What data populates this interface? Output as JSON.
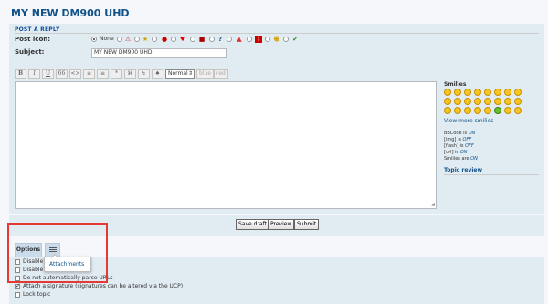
{
  "page": {
    "title": "MY NEW DM900 UHD"
  },
  "post": {
    "section_title": "POST A REPLY",
    "post_icon_label": "Post icon:",
    "none_label": "None",
    "subject_label": "Subject:",
    "subject_value": "MY NEW DM900 UHD"
  },
  "toolbar": {
    "bold": "B",
    "italic": "I",
    "underline": "U",
    "quote": "66",
    "code": "<>",
    "list": "≡",
    "list_ordered": "≡",
    "list_item": "*",
    "img": "⌘",
    "url": "↯",
    "flash": "♠",
    "font_size_value": "Normal",
    "color_blue": "blue",
    "color_red": "red"
  },
  "sidebar": {
    "smilies_title": "Smilies",
    "smilies": [
      ":D",
      ":)",
      ";)",
      ":(",
      ":o",
      ":shock:",
      ":?",
      "8-)",
      ":lol:",
      ":x",
      ":P",
      ":oops:",
      ":cry:",
      ":evil:",
      ":twisted:",
      ":roll:",
      ":!:",
      ":?:",
      ":idea:",
      ":arrow:",
      ":|",
      ":mrgreen:",
      ":geek:",
      ":ugeek:"
    ],
    "view_more": "View more smilies",
    "bbcode": "BBCode is ",
    "bbcode_state": "ON",
    "img": "[img] is ",
    "img_state": "OFF",
    "flash": "[flash] is ",
    "flash_state": "OFF",
    "url": "[url] is ",
    "url_state": "ON",
    "smilies_state_label": "Smilies are ",
    "smilies_state": "ON",
    "topic_review": "Topic review"
  },
  "buttons": {
    "save_draft": "Save draft",
    "preview": "Preview",
    "submit": "Submit"
  },
  "options": {
    "tab_label": "Options",
    "dropdown_item": "Attachments",
    "checkboxes": [
      {
        "label": "Disable",
        "checked": false
      },
      {
        "label": "Disable",
        "checked": false
      },
      {
        "label": "Do not automatically parse URLs",
        "checked": false
      },
      {
        "label": "Attach a signature (signatures can be altered via the UCP)",
        "checked": true
      },
      {
        "label": "Lock topic",
        "checked": false
      }
    ]
  },
  "colors": {
    "title_blue": "#105289",
    "panel_bg": "#e1ebf2",
    "highlight_red": "#e53935"
  }
}
